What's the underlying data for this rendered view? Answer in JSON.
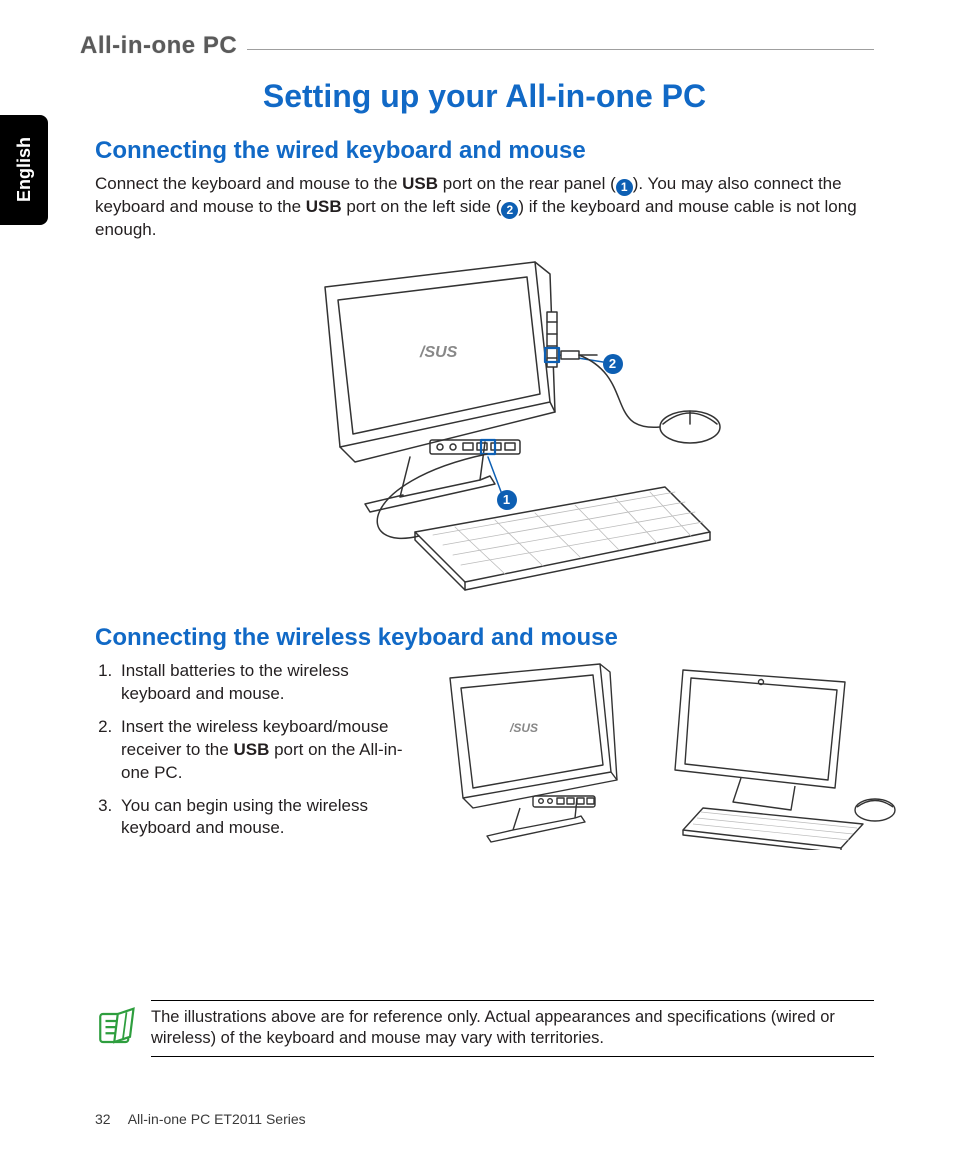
{
  "product_tag": "All-in-one PC",
  "language_tab": "English",
  "chapter_title": "Setting up your All-in-one PC",
  "section_wired_title": "Connecting the wired keyboard and mouse",
  "wired_para_part1": "Connect the keyboard and mouse to the ",
  "wired_usb1": "USB",
  "wired_para_part2": " port on the rear panel (",
  "wired_callout1": "1",
  "wired_para_part3": "). You may also connect the keyboard and mouse to the ",
  "wired_usb2": "USB",
  "wired_para_part4": " port on the left side (",
  "wired_callout2": "2",
  "wired_para_part5": ") if the keyboard and mouse cable is not long enough.",
  "fig1_label1": "1",
  "fig1_label2": "2",
  "section_wireless_title": "Connecting the wireless keyboard and mouse",
  "wireless_steps": [
    "Install batteries to the wireless keyboard and mouse.",
    "Insert the wireless keyboard/mouse receiver to the USB port on the All-in-one PC.",
    "You can begin using the wireless keyboard and mouse."
  ],
  "wireless_step2_pre": "Insert the wireless keyboard/mouse receiver to the ",
  "wireless_step2_bold": "USB",
  "wireless_step2_post": " port on the All-in-one PC.",
  "note_text": "The illustrations above are for reference only. Actual appearances and specifications (wired or wireless) of the keyboard and mouse may vary with territories.",
  "footer_page": "32",
  "footer_text": "All-in-one PC ET2011 Series"
}
